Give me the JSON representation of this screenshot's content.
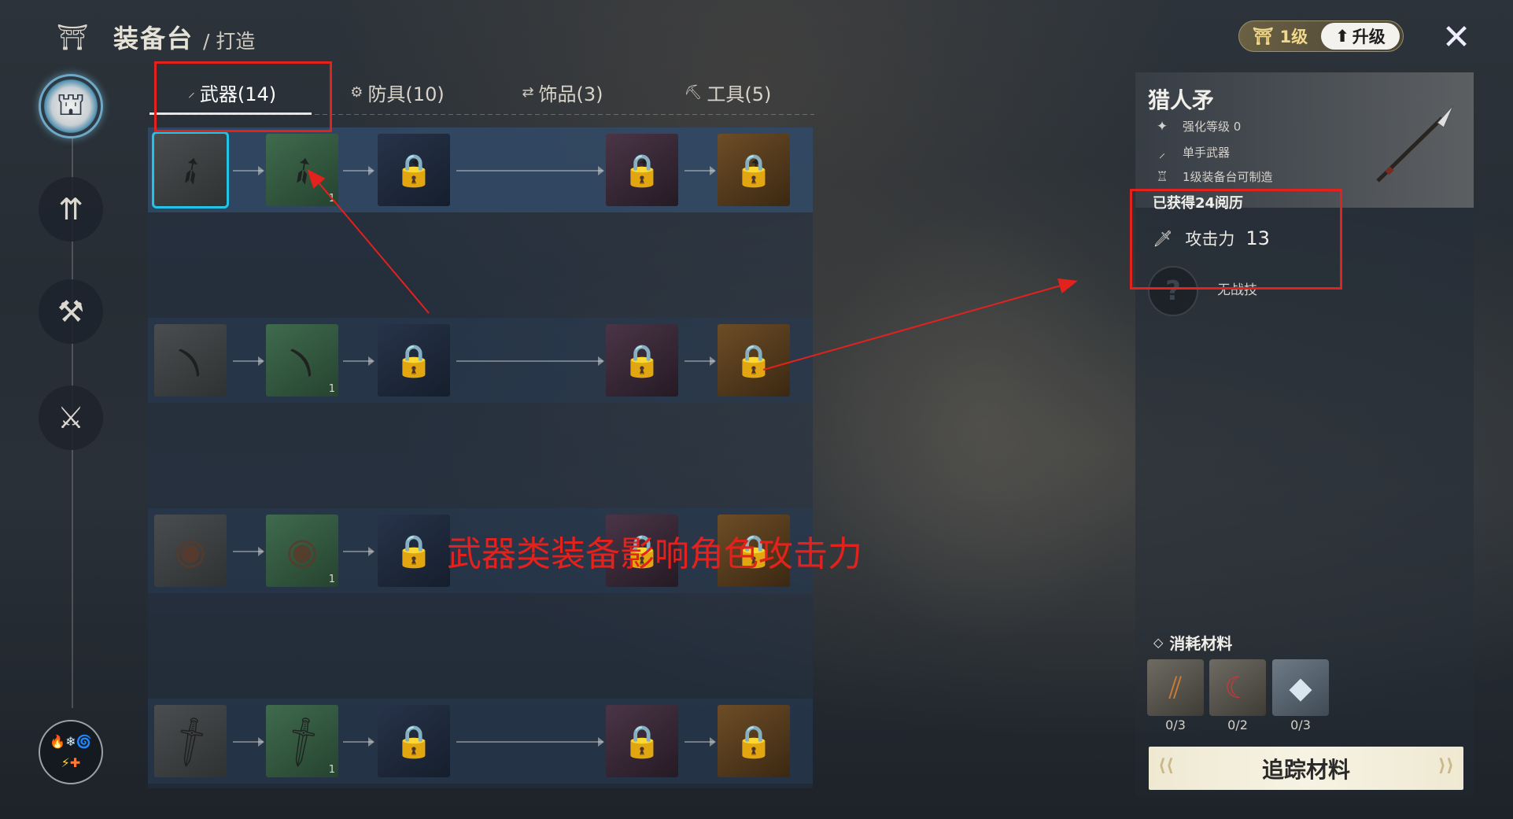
{
  "header": {
    "icon": "anvil-icon",
    "title": "装备台",
    "subtitle": "/ 打造"
  },
  "level": {
    "label": "1级",
    "upgrade": "升级",
    "colors": {
      "gold": "#f2d88a"
    }
  },
  "tabs": [
    {
      "label": "武器(14)",
      "icon": "blade-icon",
      "glyph": "⸝",
      "active": true
    },
    {
      "label": "防具(10)",
      "icon": "gear-icon",
      "glyph": "⚙",
      "active": false
    },
    {
      "label": "饰品(3)",
      "icon": "arrows-icon",
      "glyph": "⇄",
      "active": false
    },
    {
      "label": "工具(5)",
      "icon": "pickaxe-icon",
      "glyph": "⛏",
      "active": false
    }
  ],
  "rows": [
    {
      "name": "spear",
      "quantity": "1",
      "selected": true
    },
    {
      "name": "bow",
      "quantity": "1",
      "selected": false
    },
    {
      "name": "shield",
      "quantity": "1",
      "selected": false
    },
    {
      "name": "sword",
      "quantity": "1",
      "selected": false
    }
  ],
  "detail": {
    "title": "猎人矛",
    "attrs": [
      {
        "icon": "sparkle-icon",
        "glyph": "✦",
        "text": "强化等级 0"
      },
      {
        "icon": "blade-icon",
        "glyph": "⸝",
        "text": "单手武器"
      },
      {
        "icon": "anvil-icon",
        "glyph": "♖",
        "text": "1级装备台可制造"
      }
    ],
    "exp": "已获得24阅历",
    "attack_label": "攻击力",
    "attack_value": "13",
    "skill_label": "无战技",
    "skill_glyph": "?"
  },
  "materials": {
    "title": "消耗材料",
    "items": [
      {
        "icon": "wood-icon",
        "count": "0/3"
      },
      {
        "icon": "claw-icon",
        "count": "0/2"
      },
      {
        "icon": "ore-icon",
        "count": "0/3"
      }
    ],
    "track_button": "追踪材料"
  },
  "annotation": {
    "text": "武器类装备影响角色攻击力",
    "color": "#e3211d"
  }
}
